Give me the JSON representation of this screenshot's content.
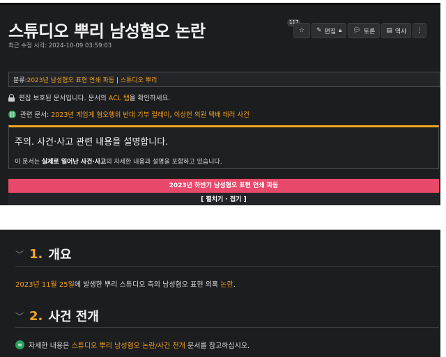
{
  "header": {
    "title": "스튜디오 뿌리 남성혐오 논란",
    "last_edited": "최근 수정 시각: 2024-10-09 03:59:03",
    "star_count": "117",
    "buttons": {
      "edit": "편집",
      "discuss": "토론",
      "history": "역사"
    },
    "icons": {
      "star": "star-icon",
      "edit": "edit-icon",
      "lock": "lock-icon",
      "discuss": "chat-icon",
      "history": "history-icon",
      "more": "more-icon"
    }
  },
  "category": {
    "label": "분류",
    "separator": ":",
    "items": [
      "2023년 남성혐오 표현 연쇄 파동",
      "스튜디오 뿌리"
    ],
    "divider": " | "
  },
  "protection": {
    "text_before": "편집 보호된 문서입니다. 문서의 ",
    "link": "ACL 탭",
    "text_after": "을 확인하세요."
  },
  "related": {
    "label": "관련 문서: ",
    "links": [
      "2023년 게임계 혐오행위 반대 기부 릴레이",
      "이상헌 의원 택배 테러 사건"
    ],
    "separator": ", "
  },
  "notice": {
    "title": "주의. 사건·사고 관련 내용을 설명합니다.",
    "body_prefix": "이 문서는 ",
    "body_bold": "실제로 일어난 사건·사고",
    "body_suffix": "의 자세한 내용과 설명을 포함하고 있습니다."
  },
  "fold": {
    "heading": "2023년 하반기 남성혐오 표현 연쇄 파동",
    "toggle": "[ 펼치기 · 접기 ]"
  },
  "sections": [
    {
      "number": "1.",
      "title": "개요",
      "date_link": "2023년 11월 25일",
      "text": "에 발생한 뿌리 스튜디오 측의 남성혐오 표현 의혹 ",
      "end_link": "논란",
      "end": "."
    },
    {
      "number": "2.",
      "title": "사건 전개",
      "text_before": "자세한 내용은 ",
      "link": "스튜디오 뿌리 남성혐오 논란/사건 전개",
      "text_after": " 문서를 참고하십시오."
    }
  ],
  "colors": {
    "background": "#1c1d1f",
    "accent_orange": "#f5a623",
    "link": "#f3a01b",
    "fold_header": "#e8496b",
    "green_icon": "#27a25c"
  }
}
